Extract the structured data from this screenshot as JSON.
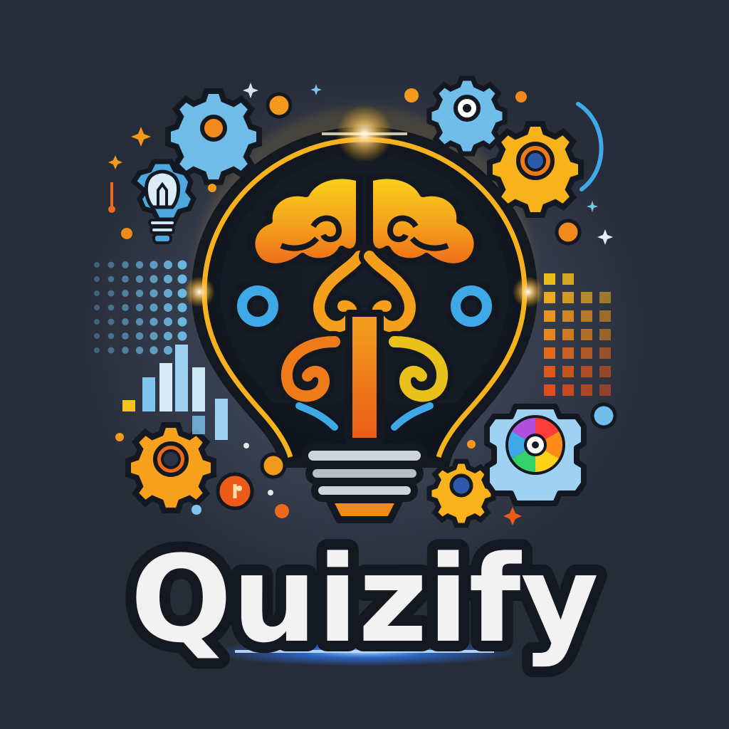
{
  "brand": {
    "name": "Quizify"
  },
  "palette": {
    "background": "#2b3240",
    "bulb_outline": "#f6b21c",
    "brain_yellow": "#f7c21a",
    "brain_orange": "#f08a1c",
    "accent_blue": "#3fa9e8",
    "gear_light_blue": "#7fc6ef",
    "text_white": "#f2f2f2",
    "text_outline": "#141820",
    "glow_blue": "#2f7cff"
  },
  "icons": [
    "lightbulb-icon",
    "brain-icon",
    "gear-icon",
    "small-lightbulb-icon",
    "color-wheel-gear-icon",
    "sparkle-icon",
    "bar-chart-icon",
    "dot-grid-pattern",
    "square-grid-pattern"
  ]
}
